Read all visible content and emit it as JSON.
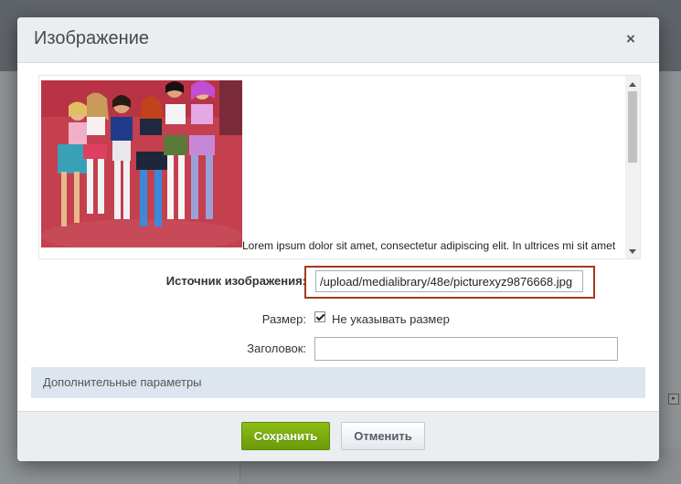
{
  "dialog": {
    "title": "Изображение",
    "close_icon": "close-icon"
  },
  "editor": {
    "image_alt": "photo of girls in colorful costumes on red carpet",
    "text": "Lorem ipsum dolor sit amet, consectetur adipiscing elit. In ultrices mi sit amet vestibulum mollis. Nunc nibh enim, convallis vel tortor eget, interdum dapibus dui. Pellentesque rhoncus"
  },
  "form": {
    "source_label": "Источник изображения:",
    "source_value": "/upload/medialibrary/48e/picturexyz9876668.jpg",
    "size_label": "Размер:",
    "size_checkbox_label": "Не указывать размер",
    "size_checkbox_checked": true,
    "title_label": "Заголовок:",
    "title_value": ""
  },
  "extra_params_label": "Дополнительные параметры",
  "buttons": {
    "save": "Сохранить",
    "cancel": "Отменить"
  },
  "colors": {
    "highlight": "#a33a1f",
    "save_button": "#7aab0f"
  }
}
